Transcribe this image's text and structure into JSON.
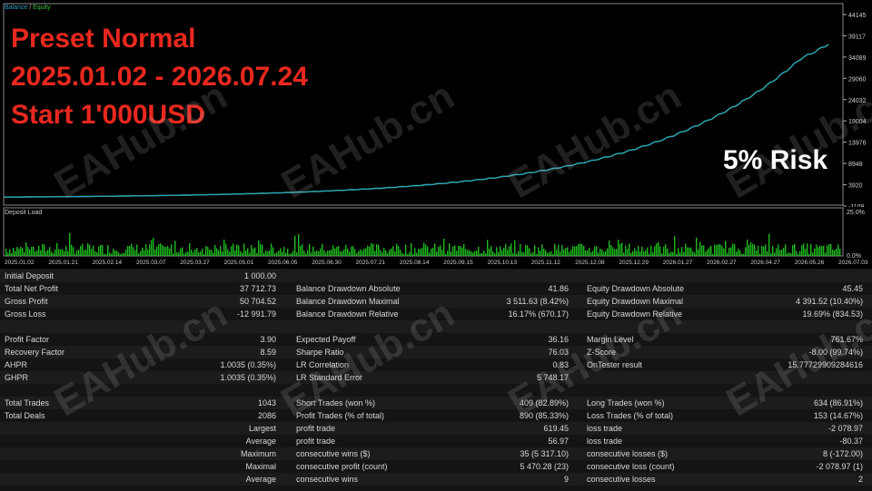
{
  "chart": {
    "legend_balance": "Balance",
    "legend_sep": " / ",
    "legend_equity": "Equity",
    "legend_load": "Deposit Load",
    "y_ticks": [
      "44145",
      "39117",
      "34089",
      "29060",
      "24032",
      "19004",
      "13976",
      "8948",
      "3920",
      "-1109"
    ],
    "load_ticks": [
      "25.0%",
      "0.0%"
    ],
    "x_ticks": [
      "2025.01.02",
      "2025.01.21",
      "2025.02.14",
      "2025.03.07",
      "2025.03.27",
      "2025.05.01",
      "2025.06.05",
      "2025.06.30",
      "2025.07.21",
      "2025.08.14",
      "2025.09.15",
      "2025.10.13",
      "2025.11.12",
      "2025.12.08",
      "2025.12.29",
      "2026.01.27",
      "2026.02.27",
      "2026.04.27",
      "2026.05.26",
      "2026.07.03"
    ],
    "balance_color": "#2aa0c8",
    "equity_color": "#3ec43e",
    "load_color": "#1fb81f"
  },
  "overlay": {
    "line1": "Preset Normal",
    "line2": "2025.01.02 - 2026.07.24",
    "line3": "Start 1'000USD",
    "risk": "5% Risk",
    "watermark": "EAHub.cn"
  },
  "stats": {
    "initial_deposit": {
      "label": "Initial Deposit",
      "value": "1 000.00"
    },
    "rows": [
      {
        "c1": "Total Net Profit",
        "v1": "37 712.73",
        "c2": "Balance Drawdown Absolute",
        "v2": "41.86",
        "c3": "Equity Drawdown Absolute",
        "v3": "45.45"
      },
      {
        "c1": "Gross Profit",
        "v1": "50 704.52",
        "c2": "Balance Drawdown Maximal",
        "v2": "3 511.63 (8.42%)",
        "c3": "Equity Drawdown Maximal",
        "v3": "4 391.52 (10.40%)"
      },
      {
        "c1": "Gross Loss",
        "v1": "-12 991.79",
        "c2": "Balance Drawdown Relative",
        "v2": "16.17% (670.17)",
        "c3": "Equity Drawdown Relative",
        "v3": "19.69% (834.53)"
      }
    ],
    "rows2": [
      {
        "c1": "Profit Factor",
        "v1": "3.90",
        "c2": "Expected Payoff",
        "v2": "36.16",
        "c3": "Margin Level",
        "v3": "761.67%"
      },
      {
        "c1": "Recovery Factor",
        "v1": "8.59",
        "c2": "Sharpe Ratio",
        "v2": "76.03",
        "c3": "Z-Score",
        "v3": "-8.00 (99.74%)"
      },
      {
        "c1": "AHPR",
        "v1": "1.0035 (0.35%)",
        "c2": "LR Correlation",
        "v2": "0.83",
        "c3": "OnTester result",
        "v3": "15.77729909284616"
      },
      {
        "c1": "GHPR",
        "v1": "1.0035 (0.35%)",
        "c2": "LR Standard Error",
        "v2": "5 748.17",
        "c3": "",
        "v3": ""
      }
    ],
    "rows3": [
      {
        "c1": "Total Trades",
        "v1": "1043",
        "c2": "Short Trades (won %)",
        "v2": "409 (82.89%)",
        "c3": "Long Trades (won %)",
        "v3": "634 (86.91%)"
      },
      {
        "c1": "Total Deals",
        "v1": "2086",
        "c2": "Profit Trades (% of total)",
        "v2": "890 (85.33%)",
        "c3": "Loss Trades (% of total)",
        "v3": "153 (14.67%)"
      },
      {
        "c1": "",
        "v1": "Largest",
        "c2": "profit trade",
        "v2": "619.45",
        "c3": "loss trade",
        "v3": "-2 078.97"
      },
      {
        "c1": "",
        "v1": "Average",
        "c2": "profit trade",
        "v2": "56.97",
        "c3": "loss trade",
        "v3": "-80.37"
      },
      {
        "c1": "",
        "v1": "Maximum",
        "c2": "consecutive wins ($)",
        "v2": "35 (5 317.10)",
        "c3": "consecutive losses ($)",
        "v3": "8 (-172.00)"
      },
      {
        "c1": "",
        "v1": "Maximal",
        "c2": "consecutive profit (count)",
        "v2": "5 470.28 (23)",
        "c3": "consecutive loss (count)",
        "v3": "-2 078.97 (1)"
      },
      {
        "c1": "",
        "v1": "Average",
        "c2": "consecutive wins",
        "v2": "9",
        "c3": "consecutive losses",
        "v3": "2"
      }
    ]
  }
}
